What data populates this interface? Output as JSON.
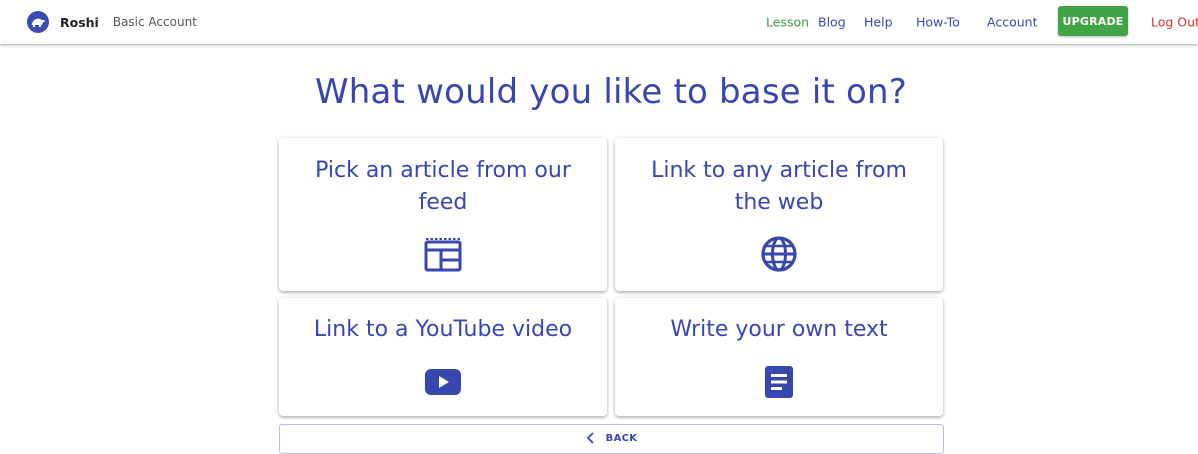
{
  "header": {
    "brand": "Roshi",
    "account_type": "Basic Account",
    "nav": {
      "lesson": "Lesson",
      "blog": "Blog",
      "help": "Help",
      "howto": "How-To",
      "account": "Account",
      "upgrade": "UPGRADE",
      "logout": "Log Out"
    }
  },
  "main": {
    "title": "What would you like to base it on?",
    "options": [
      {
        "label": "Pick an article from our feed",
        "icon": "feed-layout-icon"
      },
      {
        "label": "Link to any article from the web",
        "icon": "globe-icon"
      },
      {
        "label": "Link to a YouTube video",
        "icon": "youtube-play-icon"
      },
      {
        "label": "Write your own text",
        "icon": "document-text-icon"
      }
    ],
    "back_label": "BACK"
  },
  "colors": {
    "primary": "#3846b0",
    "lesson_green": "#3f9a3f",
    "upgrade_green": "#3fa544",
    "logout_red": "#d9302f"
  }
}
